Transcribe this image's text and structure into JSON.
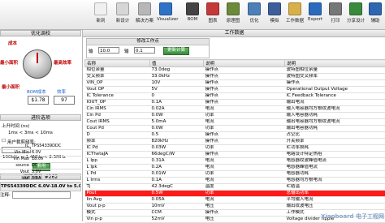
{
  "toolbar": {
    "buttons": [
      {
        "label": "新到",
        "icon": "new-icon",
        "color": "#e9e9e9"
      },
      {
        "label": "新设计",
        "icon": "design-icon",
        "color": "#d6d6d6"
      },
      {
        "label": "解决方案",
        "icon": "solution-icon",
        "color": "#b7b7b7"
      },
      {
        "label": "Visualizer",
        "icon": "visualizer-icon",
        "color": "#2f72c6"
      },
      {
        "label": "BOM",
        "icon": "bom-icon",
        "color": "#444444"
      },
      {
        "label": "图表",
        "icon": "chart-icon",
        "color": "#c43a3a"
      },
      {
        "label": "原理图",
        "icon": "schematic-icon",
        "color": "#6b8a3a"
      },
      {
        "label": "优化",
        "icon": "optimize-icon",
        "color": "#4d7fb8"
      },
      {
        "label": "模拟",
        "icon": "simulate-icon",
        "color": "#3c5f9a"
      },
      {
        "label": "工作数据",
        "icon": "data-icon",
        "color": "#d8b04a"
      },
      {
        "label": "Export",
        "icon": "export-icon",
        "color": "#2a6bbf"
      },
      {
        "label": "打印",
        "icon": "print-icon",
        "color": "#777777"
      },
      {
        "label": "分享设计",
        "icon": "share-icon",
        "color": "#3a8a3c"
      },
      {
        "label": "辅助",
        "icon": "help-icon",
        "color": "#2f66b1"
      }
    ]
  },
  "left": {
    "optimize_title": "优化调校",
    "knob_labels": {
      "top": "成本",
      "left": "最小面积",
      "right": "最高效率",
      "bottom_left": "最小面积",
      "eff": "效率"
    },
    "values": {
      "bom_cost": "$1.78",
      "eff": "97"
    },
    "value_captions": {
      "bom": "BOM成本",
      "eff": "效率"
    },
    "advanced_title": "进阶选项",
    "ripple_label": "上升时间 (ns)",
    "ripple_range": "1ms < 3ms < 10ms",
    "override_label": "用户裁剪频率:",
    "freq_range": "100kHz < 1.4MHz < 2.5MHz",
    "apply_button": "套用",
    "op_title": "运行设计 #262",
    "op_rows": [
      {
        "k": "IC",
        "v": "TPS54339DDC"
      },
      {
        "k": "Vin Min",
        "v": "6.0V"
      },
      {
        "k": "Vin Max",
        "v": "18.0V"
      },
      {
        "k": "source",
        "v": "DC"
      },
      {
        "k": "Vout",
        "v": "5.0V"
      },
      {
        "k": "Iout",
        "v": "3.0A"
      }
    ],
    "footer_title": "TPS54339DDC 6.0V-18.0V to 5.0V @ 3A",
    "footer_note_label": "注释:"
  },
  "right": {
    "title": "工作数据",
    "modify_title": "修改工作点",
    "vin_label": "输",
    "vin_value": "10.0",
    "iout_label": "输",
    "iout_value": "0.1",
    "update_button": "更新计算",
    "columns": [
      "名称",
      "值",
      "说明",
      "说明"
    ],
    "rows": [
      [
        "相位余量",
        "73.0deg",
        "操作点",
        "波特图相位余量"
      ],
      [
        "交叉频率",
        "33.0kHz",
        "操作点",
        "波特图交叉频率"
      ],
      [
        "VIN_OP",
        "10V",
        "操作点",
        "操作点"
      ],
      [
        "Vout OP",
        "5V",
        "操作点",
        "Operational Output Voltage"
      ],
      [
        "IC Tolerance",
        "0",
        "操作点",
        "IC Feedback Tolerance"
      ],
      [
        "IOUT_OP",
        "0.1A",
        "操作点",
        "输出电流"
      ],
      [
        "Cin IRMS",
        "0.02A",
        "电流",
        "输入电容器均方根纹波电流"
      ],
      [
        "Cin Pd",
        "0.0W",
        "功率",
        "输入电容器功耗"
      ],
      [
        "Cout IRMS",
        "5.0mA",
        "电流",
        "输出电容器均方根纹波电流"
      ],
      [
        "Cout Pd",
        "0.0W",
        "功率",
        "输出电容器功耗"
      ],
      [
        "D",
        "0.5",
        "操作点",
        "占空比"
      ],
      [
        "频率",
        "820kHz",
        "操作点",
        "开关频率"
      ],
      [
        "IC Pd",
        "0.03W",
        "功率",
        "IC功率损耗"
      ],
      [
        "ICThetaJA",
        "66degC/W",
        "操作点",
        "电路设计特定热阻"
      ],
      [
        "L Ipp",
        "0.31A",
        "电流",
        "电感器纹波峰值电流"
      ],
      [
        "L Ipk",
        "0.2A",
        "电流",
        "电感器峰值电流"
      ],
      [
        "L Pd",
        "0.01W",
        "功率",
        "电感器功耗"
      ],
      [
        "L Irms",
        "0.1A",
        "电流",
        "电感器均方根电流"
      ],
      [
        "Tj",
        "42.3degC",
        "温度",
        "IC结温"
      ],
      [
        "Pout",
        "0.5W",
        "功率",
        "总输出功率"
      ],
      [
        "Iin Avg",
        "0.05A",
        "电流",
        "平均输入电流"
      ],
      [
        "Vout p-p",
        "10mV",
        "电压",
        "输出纹波电压"
      ],
      [
        "模式",
        "CCM",
        "操作点",
        "工作模式"
      ],
      [
        "Vin p-p",
        "52mV",
        "电压",
        "Voltage divider ripple"
      ]
    ],
    "highlight_row": 19
  },
  "watermark": "Xianboard 电子工程网"
}
